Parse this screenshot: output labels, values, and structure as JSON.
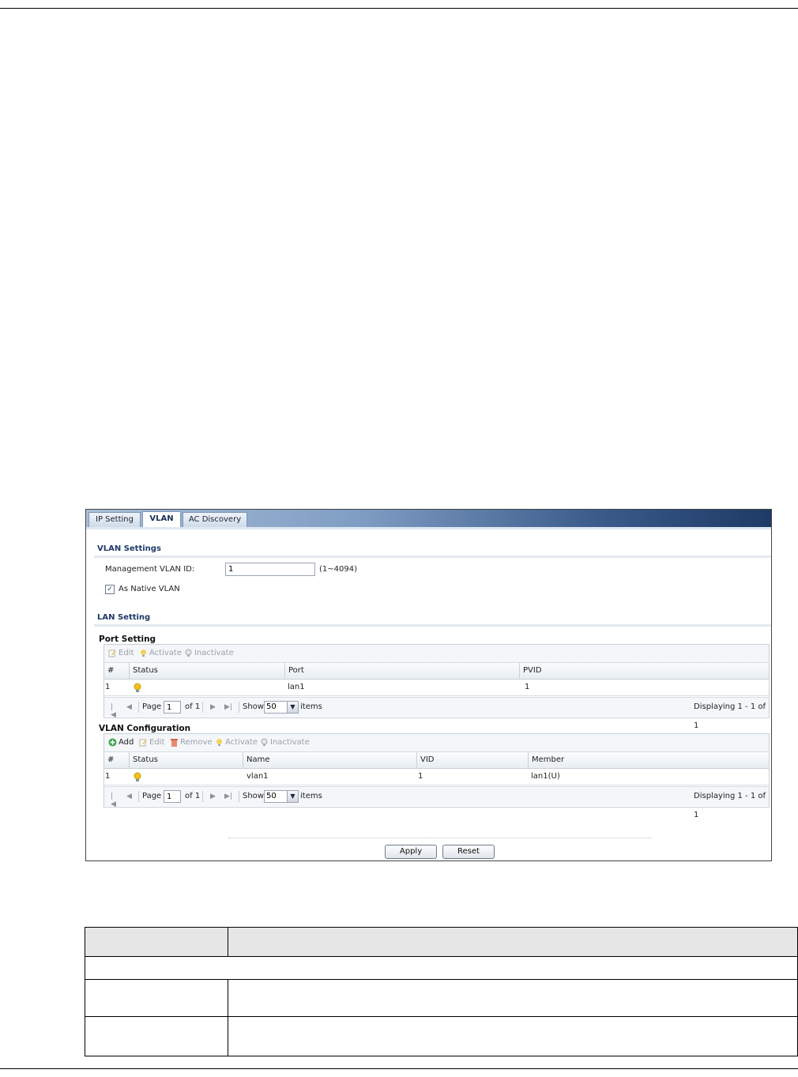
{
  "tabs": [
    {
      "label": "IP Setting"
    },
    {
      "label": "VLAN"
    },
    {
      "label": "AC Discovery"
    }
  ],
  "vlan_settings": {
    "title": "VLAN Settings",
    "mgmt_label": "Management VLAN ID:",
    "mgmt_value": "1",
    "mgmt_range": "(1~4094)",
    "native_label": "As Native VLAN",
    "native_checked": true
  },
  "lan_setting": {
    "title": "LAN Setting"
  },
  "port_setting": {
    "title": "Port Setting",
    "toolbar": {
      "edit": "Edit",
      "activate": "Activate",
      "inactivate": "Inactivate"
    },
    "columns": [
      "#",
      "Status",
      "Port",
      "PVID"
    ],
    "rows": [
      {
        "num": "1",
        "status_icon": "lightbulb-on-icon",
        "port": "lan1",
        "pvid": "1"
      }
    ],
    "pager": {
      "page_label": "Page",
      "page": "1",
      "of": "of 1",
      "show": "Show",
      "per_page": "50",
      "items": "items",
      "displaying": "Displaying 1 - 1 of 1"
    }
  },
  "vlan_config": {
    "title": "VLAN Configuration",
    "toolbar": {
      "add": "Add",
      "edit": "Edit",
      "remove": "Remove",
      "activate": "Activate",
      "inactivate": "Inactivate"
    },
    "columns": [
      "#",
      "Status",
      "Name",
      "VID",
      "Member"
    ],
    "rows": [
      {
        "num": "1",
        "status_icon": "lightbulb-on-icon",
        "name": "vlan1",
        "vid": "1",
        "member": "lan1(U)"
      }
    ],
    "pager": {
      "page_label": "Page",
      "page": "1",
      "of": "of 1",
      "show": "Show",
      "per_page": "50",
      "items": "items",
      "displaying": "Displaying 1 - 1 of 1"
    }
  },
  "buttons": {
    "apply": "Apply",
    "reset": "Reset"
  },
  "colors": {
    "tab_gradient_end": "#1e3a66",
    "section_title": "#1f3a68",
    "bulb": "#f2c419"
  }
}
